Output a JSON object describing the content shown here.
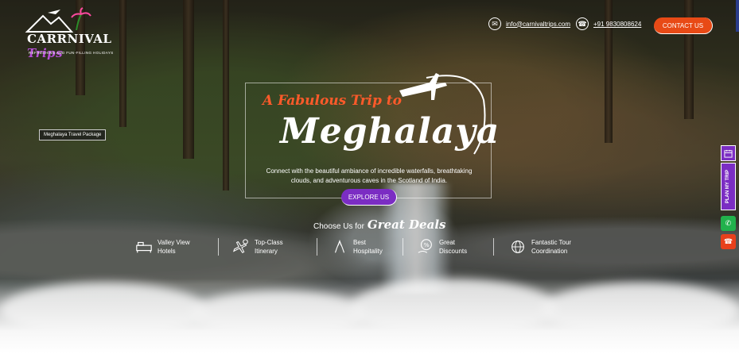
{
  "header": {
    "logo": {
      "name": "CARRNIVAL",
      "name_accent": "Trips",
      "tagline": "REFRESHING AND FUN-FILLING HOLIDAYS"
    },
    "email": "info@carnivaltrips.com",
    "phone": "+91 9830808624",
    "contact_button": "CONTACT US"
  },
  "side_tag": "Meghalaya Travel Package",
  "hero": {
    "tagline": "A Fabulous Trip to",
    "title": "Meghalaya",
    "description": "Connect with the beautiful ambiance of incredible waterfalls, breathtaking clouds, and adventurous caves in the Scotland of India.",
    "explore_button": "EXPLORE US"
  },
  "deals": {
    "heading_small": "Choose Us for",
    "heading_big": "Great Deals",
    "features": [
      {
        "line1": "Valley View",
        "line2": "Hotels",
        "icon": "bed-icon"
      },
      {
        "line1": "Top-Class",
        "line2": "Itinerary",
        "icon": "plane-pin-icon"
      },
      {
        "line1": "Best",
        "line2": "Hospitality",
        "icon": "hands-icon"
      },
      {
        "line1": "Great",
        "line2": "Discounts",
        "icon": "discount-icon"
      },
      {
        "line1": "Fantastic Tour",
        "line2": "Coordination",
        "icon": "globe-icon"
      }
    ]
  },
  "side_actions": {
    "plan_label": "PLAN MY TRIP",
    "icons": [
      "calendar-icon",
      "whatsapp-icon",
      "phone-icon"
    ],
    "colors": {
      "plan": "#7b2dc3",
      "whatsapp": "#22b14c",
      "call": "#e8401c"
    }
  },
  "colors": {
    "accent_orange": "#e84a16",
    "accent_purple": "#7b2dc3",
    "tagline": "#ff5a2a"
  }
}
